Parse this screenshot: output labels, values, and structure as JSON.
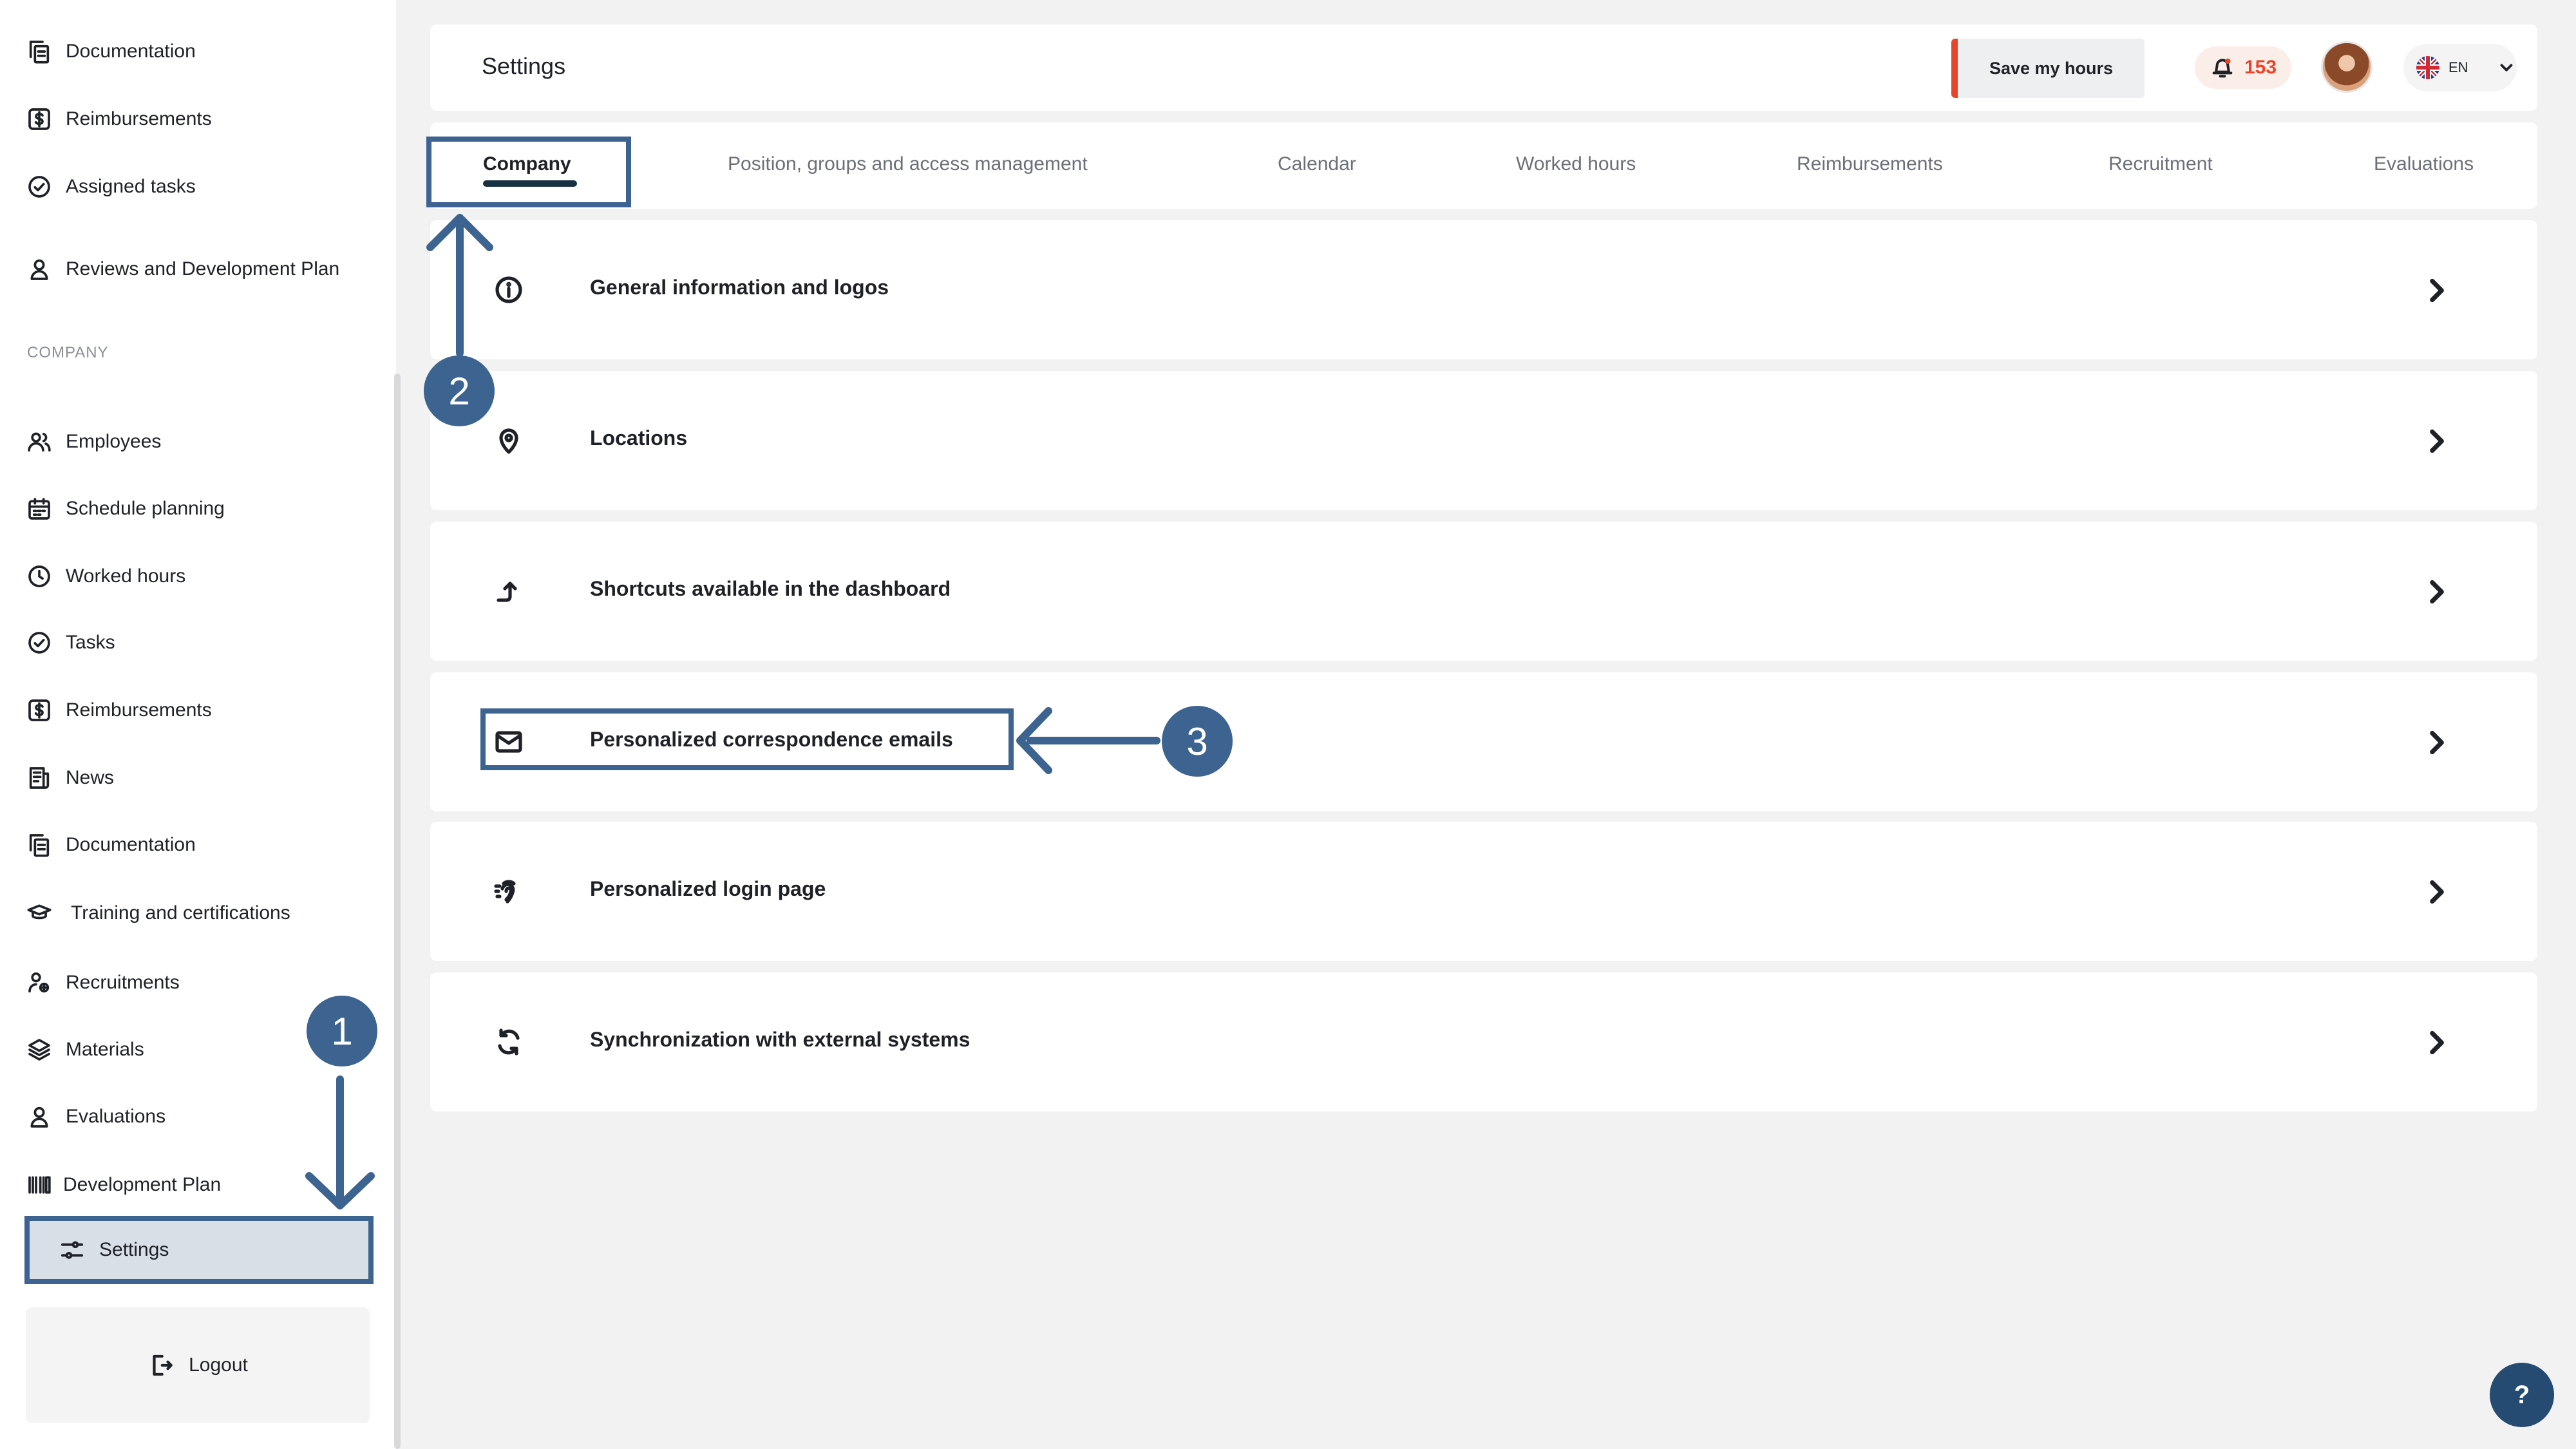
{
  "sidebar": {
    "items_top": [
      {
        "label": "Documentation",
        "icon": "documents-icon"
      },
      {
        "label": "Reimbursements",
        "icon": "dollar-icon"
      },
      {
        "label": "Assigned tasks",
        "icon": "check-circle-icon"
      },
      {
        "label": "Reviews and Development Plan",
        "icon": "user-icon"
      }
    ],
    "section_label": "COMPANY",
    "items_company": [
      {
        "label": "Employees",
        "icon": "users-icon"
      },
      {
        "label": "Schedule planning",
        "icon": "calendar-icon"
      },
      {
        "label": "Worked hours",
        "icon": "clock-icon"
      },
      {
        "label": "Tasks",
        "icon": "check-circle-icon"
      },
      {
        "label": "Reimbursements",
        "icon": "dollar-icon"
      },
      {
        "label": "News",
        "icon": "news-icon"
      },
      {
        "label": "Documentation",
        "icon": "documents-icon"
      },
      {
        "label": "Training and certifications",
        "icon": "graduation-cap-icon"
      },
      {
        "label": "Recruitments",
        "icon": "user-search-icon"
      },
      {
        "label": "Materials",
        "icon": "layers-icon"
      },
      {
        "label": "Evaluations",
        "icon": "user-icon"
      },
      {
        "label": "Development Plan",
        "icon": "barcode-icon"
      }
    ],
    "settings_label": "Settings",
    "logout_label": "Logout"
  },
  "header": {
    "title": "Settings",
    "save_label": "Save my hours",
    "notification_count": "153",
    "language": "EN"
  },
  "tabs": [
    {
      "label": "Company",
      "active": true
    },
    {
      "label": "Position, groups and access management",
      "active": false
    },
    {
      "label": "Calendar",
      "active": false
    },
    {
      "label": "Worked hours",
      "active": false
    },
    {
      "label": "Reimbursements",
      "active": false
    },
    {
      "label": "Recruitment",
      "active": false
    },
    {
      "label": "Evaluations",
      "active": false
    }
  ],
  "rows": [
    {
      "label": "General information and logos",
      "icon": "info-icon"
    },
    {
      "label": "Locations",
      "icon": "location-pin-icon"
    },
    {
      "label": "Shortcuts available in the dashboard",
      "icon": "shortcut-arrow-icon"
    },
    {
      "label": "Personalized correspondence emails",
      "icon": "mail-icon"
    },
    {
      "label": "Personalized login page",
      "icon": "fingerprint-icon"
    },
    {
      "label": "Synchronization with external systems",
      "icon": "sync-icon"
    }
  ],
  "annotations": {
    "step1": "1",
    "step2": "2",
    "step3": "3"
  },
  "help_label": "?",
  "colors": {
    "accent_blue": "#3d6391",
    "brand_orange": "#e8462a",
    "dark_navy": "#173042"
  }
}
